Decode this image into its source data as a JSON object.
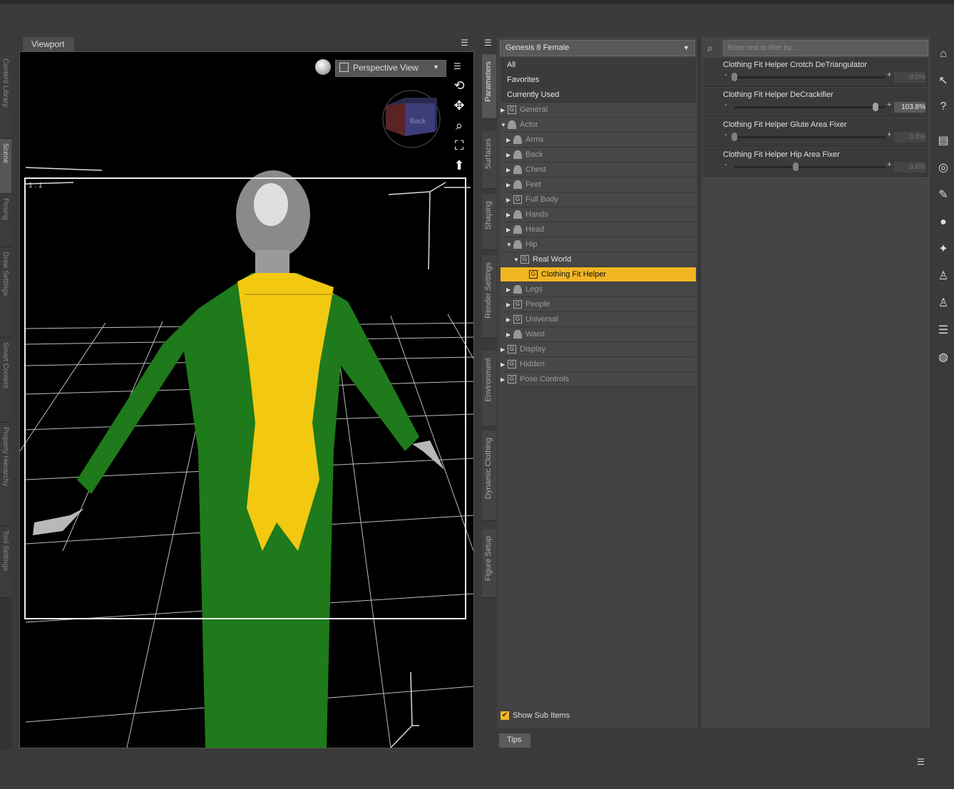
{
  "viewport": {
    "tab_label": "Viewport",
    "view_mode": "Perspective View",
    "ratio": "1 : 1",
    "cube_face": "Back"
  },
  "left_tabs": [
    "Content Library",
    "Scene",
    "Posing",
    "Draw Settings",
    "Smart Content",
    "Property Hierarchy",
    "Tool Settings"
  ],
  "mid_tabs": [
    "Parameters",
    "Surfaces",
    "Shaping",
    "Render Settings",
    "Environment",
    "Dynamic Clothing",
    "Figure Setup"
  ],
  "tree": {
    "figure": "Genesis 8 Female",
    "top_items": [
      "All",
      "Favorites",
      "Currently Used"
    ],
    "general": "General",
    "actor": "Actor",
    "arms": "Arms",
    "back": "Back",
    "chest": "Chest",
    "feet": "Feet",
    "full_body": "Full Body",
    "hands": "Hands",
    "head": "Head",
    "hip": "Hip",
    "real_world": "Real World",
    "clothing_fit_helper": "Clothing Fit Helper",
    "legs": "Legs",
    "people": "People",
    "universal": "Universal",
    "waist": "Waist",
    "display": "Display",
    "hidden": "Hidden",
    "pose_controls": "Pose Controls",
    "show_sub_items": "Show Sub Items",
    "group_glyph": "G"
  },
  "filter": {
    "placeholder": "Enter text to filter by..."
  },
  "params": [
    {
      "label": "Clothing Fit Helper Crotch DeTriangulator",
      "value": "0.0%",
      "level": 0.0
    },
    {
      "label": "Clothing Fit Helper DeCrackifier",
      "value": "103.8%",
      "level": 1.0
    },
    {
      "label": "Clothing Fit Helper Glute Area Fixer",
      "value": "0.0%",
      "level": 0.0
    },
    {
      "label": "Clothing Fit Helper Hip Area Fixer",
      "value": "0.0%",
      "level": 0.4
    }
  ],
  "tips": {
    "label": "Tips"
  },
  "right_icons": [
    "home-icon",
    "whats-this-icon",
    "help-icon",
    "panel-icon",
    "target-icon",
    "pose-tool-icon",
    "node-icon",
    "joint-editor-icon",
    "figure-icon",
    "figure-alt-icon",
    "align-icon",
    "globe-icon"
  ],
  "colors": {
    "selection": "#f2b624",
    "suit_green": "#1e7a1a",
    "suit_yellow": "#f2c811"
  }
}
